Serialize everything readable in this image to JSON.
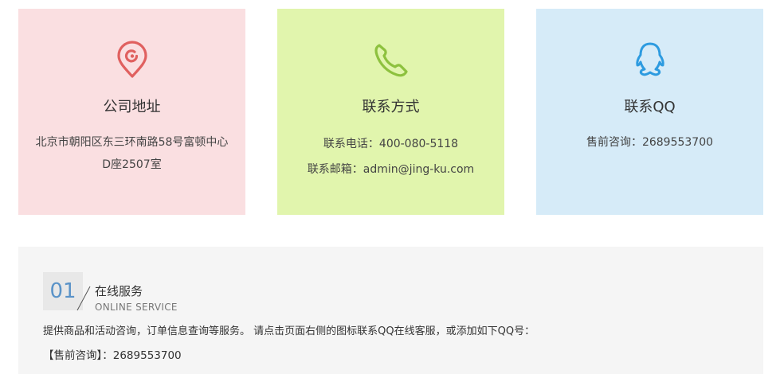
{
  "cards": {
    "address": {
      "icon": "location-pin-icon",
      "title": "公司地址",
      "lines": [
        "北京市朝阳区东三环南路58号富顿中心",
        "D座2507室"
      ],
      "bg_color": "#fadfe1",
      "icon_color": "#e0605f"
    },
    "phone": {
      "icon": "phone-icon",
      "title": "联系方式",
      "lines": [
        "联系电话：400-080-5118",
        "联系邮箱：admin@jing-ku.com"
      ],
      "bg_color": "#e1f5ad",
      "icon_color": "#8dc13e"
    },
    "qq": {
      "icon": "qq-penguin-icon",
      "title": "联系QQ",
      "lines": [
        "售前咨询：2689553700"
      ],
      "bg_color": "#d6ebf8",
      "icon_color": "#2d9be0"
    }
  },
  "service": {
    "number": "01",
    "title": "在线服务",
    "subtitle": "ONLINE SERVICE",
    "description": "提供商品和活动咨询，订单信息查询等服务。 请点击页面右侧的图标联系QQ在线客服，或添加如下QQ号：",
    "qq_line": "【售前咨询】：2689553700",
    "number_color": "#5a93c8"
  }
}
